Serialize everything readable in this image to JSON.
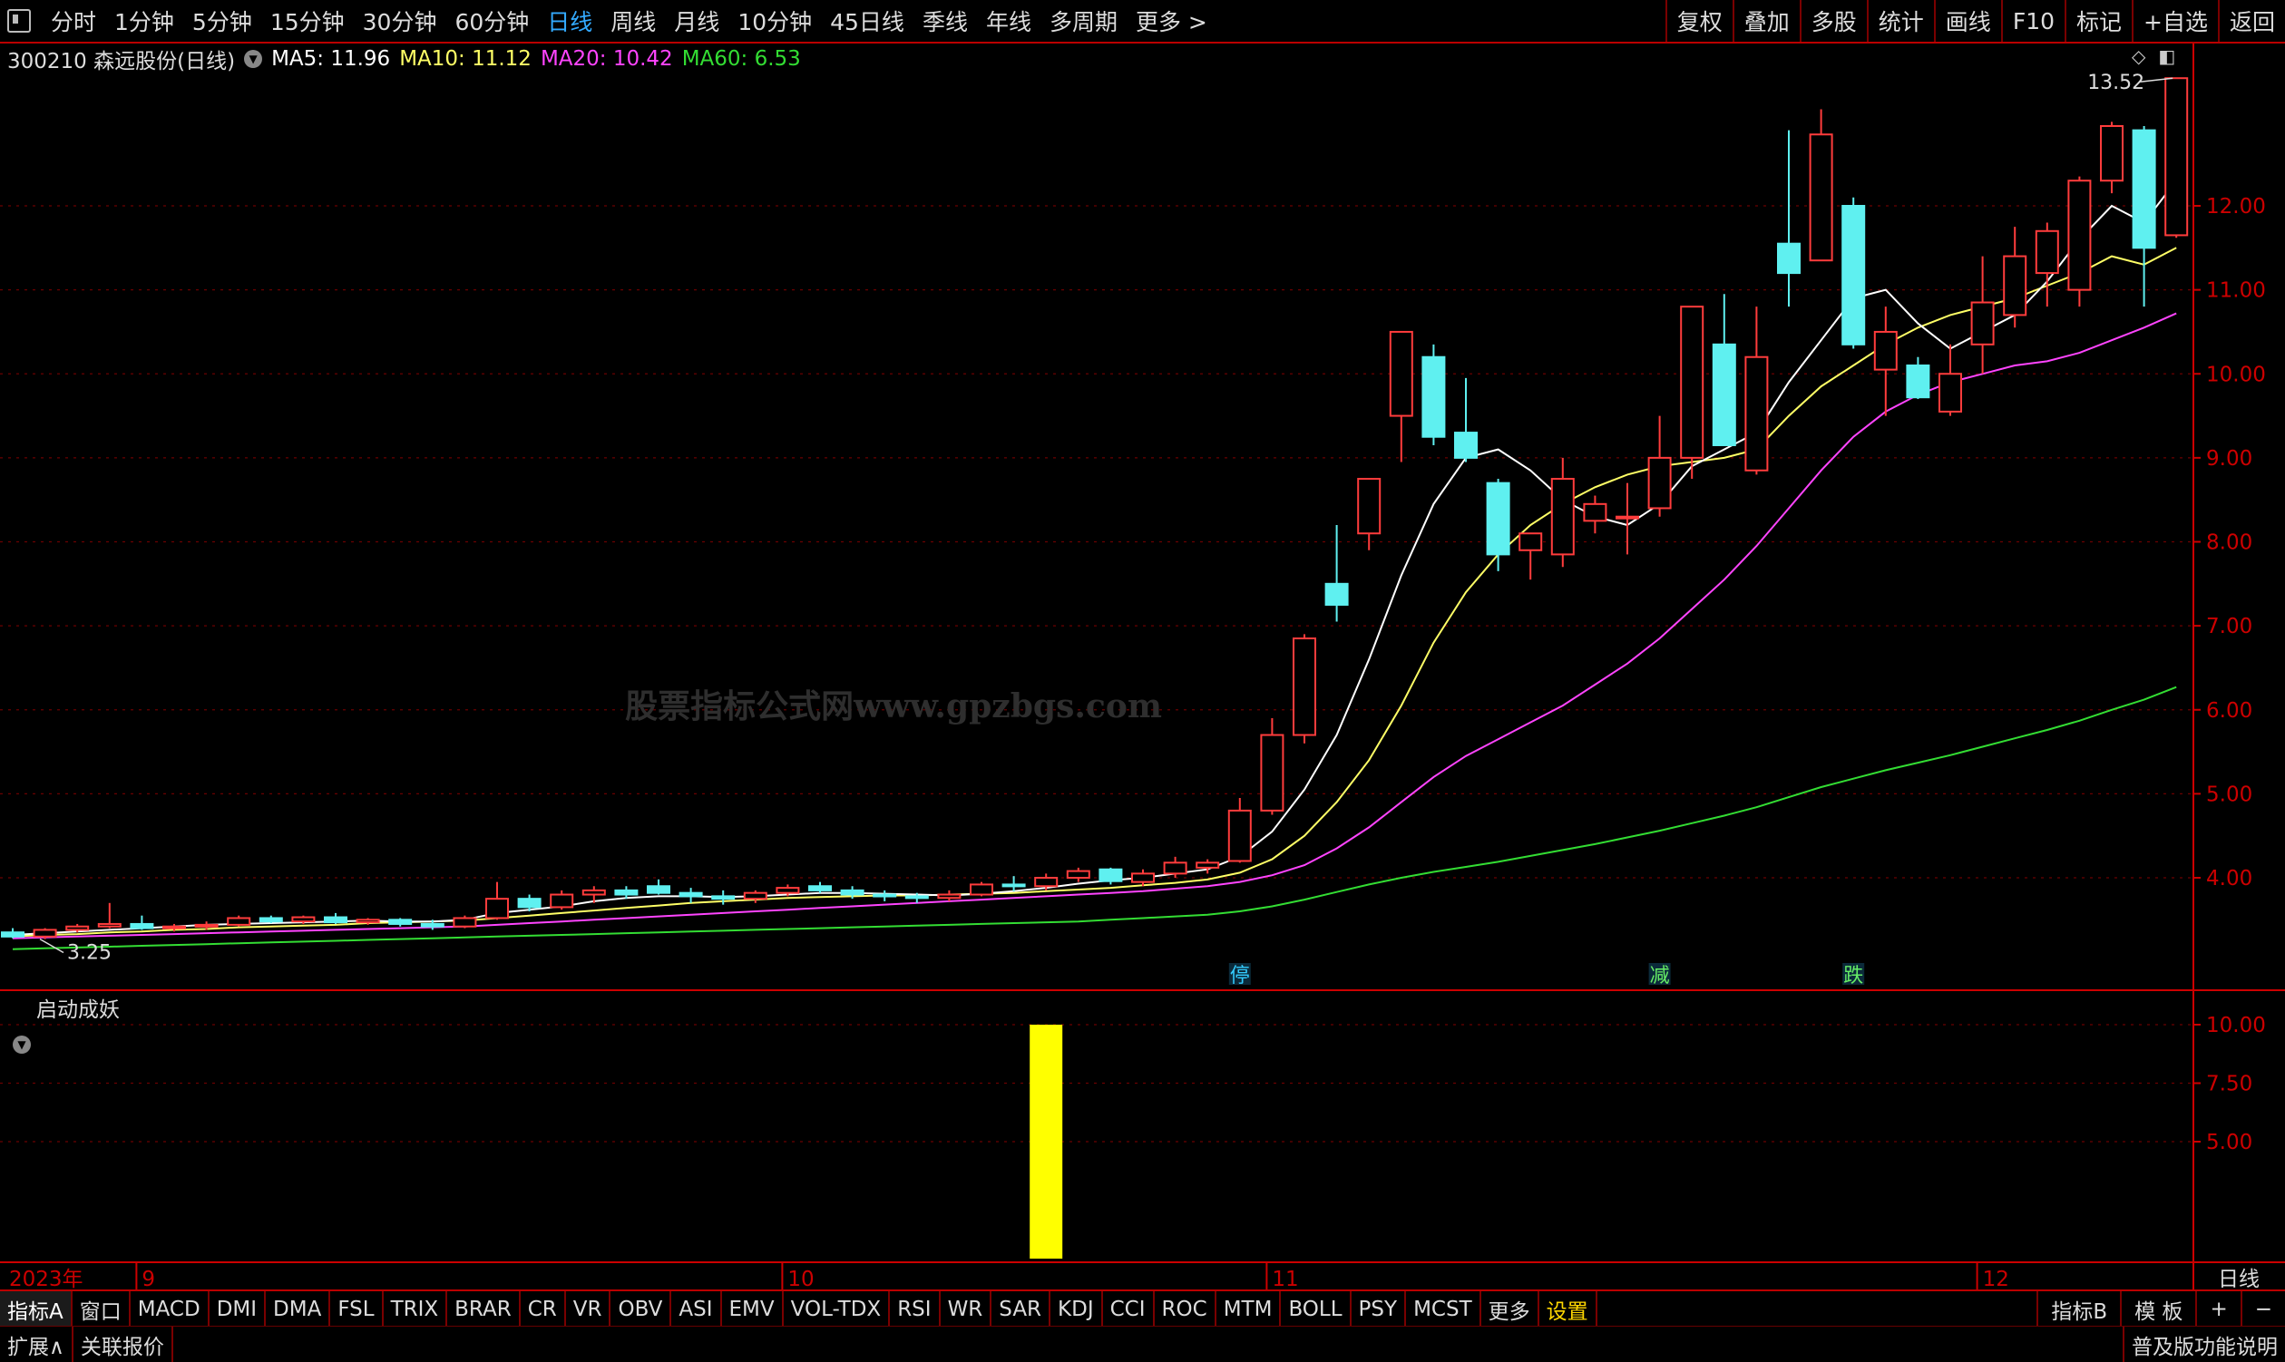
{
  "top_tabs": [
    "分时",
    "1分钟",
    "5分钟",
    "15分钟",
    "30分钟",
    "60分钟",
    "日线",
    "周线",
    "月线",
    "10分钟",
    "45日线",
    "季线",
    "年线",
    "多周期",
    "更多 >"
  ],
  "top_active": "日线",
  "right_tabs": [
    "复权",
    "叠加",
    "多股",
    "统计",
    "画线",
    "F10",
    "标记",
    "+自选",
    "返回"
  ],
  "stock": {
    "title": "300210 森远股份(日线)",
    "ma5": "MA5: 11.96",
    "ma10": "MA10: 11.12",
    "ma20": "MA20: 10.42",
    "ma60": "MA60: 6.53"
  },
  "colors": {
    "up": "#ff3c3c",
    "down": "#5ff0f0",
    "ma5": "#ffffff",
    "ma10": "#ffff66",
    "ma20": "#ff44ff",
    "ma60": "#33dd33",
    "axis": "#cc0000",
    "signal": "#ffff00"
  },
  "watermark": "股票指标公式网www.gpzbgs.com",
  "high_label": "13.52",
  "low_label": "3.25",
  "markers": [
    {
      "text": "停",
      "index": 38
    },
    {
      "text": "减",
      "index": 51
    },
    {
      "text": "跌",
      "index": 57
    }
  ],
  "price_axis": [
    "12.00",
    "11.00",
    "10.00",
    "9.00",
    "8.00",
    "7.00",
    "6.00",
    "5.00",
    "4.00"
  ],
  "sub_indicator": {
    "name": "启动成妖",
    "axis": [
      "10.00",
      "7.50",
      "5.00"
    ],
    "signal_index": 32,
    "signal_value": 10
  },
  "time_axis": {
    "year": "2023年",
    "months": [
      {
        "label": "9",
        "index": 4
      },
      {
        "label": "10",
        "index": 24
      },
      {
        "label": "11",
        "index": 39
      },
      {
        "label": "12",
        "index": 61
      }
    ],
    "period": "日线"
  },
  "bottom_tabs": [
    "指标A",
    "窗口",
    "MACD",
    "DMI",
    "DMA",
    "FSL",
    "TRIX",
    "BRAR",
    "CR",
    "VR",
    "OBV",
    "ASI",
    "EMV",
    "VOL-TDX",
    "RSI",
    "WR",
    "SAR",
    "KDJ",
    "CCI",
    "ROC",
    "MTM",
    "BOLL",
    "PSY",
    "MCST",
    "更多",
    "设置"
  ],
  "bottom_right": [
    "指标B",
    "模 板",
    "+",
    "−"
  ],
  "bottom_row2": [
    "扩展∧",
    "关联报价"
  ],
  "bottom_row2_right": "普及版功能说明",
  "chart_data": {
    "type": "candlestick",
    "title": "300210 森远股份(日线)",
    "ylim": [
      3.0,
      14.0
    ],
    "candles": [
      [
        3.35,
        3.4,
        3.28,
        3.3
      ],
      [
        3.3,
        3.4,
        3.27,
        3.38
      ],
      [
        3.38,
        3.45,
        3.35,
        3.42
      ],
      [
        3.42,
        3.7,
        3.4,
        3.45
      ],
      [
        3.45,
        3.55,
        3.38,
        3.4
      ],
      [
        3.4,
        3.45,
        3.36,
        3.42
      ],
      [
        3.42,
        3.48,
        3.38,
        3.44
      ],
      [
        3.44,
        3.55,
        3.42,
        3.52
      ],
      [
        3.52,
        3.55,
        3.46,
        3.48
      ],
      [
        3.48,
        3.55,
        3.45,
        3.53
      ],
      [
        3.53,
        3.58,
        3.45,
        3.47
      ],
      [
        3.47,
        3.52,
        3.44,
        3.5
      ],
      [
        3.5,
        3.52,
        3.42,
        3.45
      ],
      [
        3.45,
        3.5,
        3.38,
        3.42
      ],
      [
        3.42,
        3.55,
        3.4,
        3.52
      ],
      [
        3.52,
        3.95,
        3.5,
        3.75
      ],
      [
        3.75,
        3.8,
        3.6,
        3.65
      ],
      [
        3.65,
        3.85,
        3.62,
        3.8
      ],
      [
        3.8,
        3.9,
        3.7,
        3.85
      ],
      [
        3.85,
        3.9,
        3.75,
        3.8
      ],
      [
        3.9,
        3.98,
        3.8,
        3.82
      ],
      [
        3.82,
        3.88,
        3.7,
        3.78
      ],
      [
        3.78,
        3.85,
        3.68,
        3.75
      ],
      [
        3.75,
        3.85,
        3.7,
        3.82
      ],
      [
        3.82,
        3.92,
        3.78,
        3.88
      ],
      [
        3.9,
        3.95,
        3.82,
        3.85
      ],
      [
        3.85,
        3.9,
        3.75,
        3.8
      ],
      [
        3.8,
        3.85,
        3.72,
        3.78
      ],
      [
        3.78,
        3.82,
        3.7,
        3.76
      ],
      [
        3.76,
        3.85,
        3.72,
        3.8
      ],
      [
        3.8,
        3.95,
        3.78,
        3.92
      ],
      [
        3.92,
        4.02,
        3.84,
        3.9
      ],
      [
        3.9,
        4.05,
        3.85,
        4.0
      ],
      [
        4.0,
        4.12,
        3.95,
        4.08
      ],
      [
        4.1,
        4.12,
        3.92,
        3.96
      ],
      [
        3.95,
        4.1,
        3.9,
        4.05
      ],
      [
        4.05,
        4.25,
        4.0,
        4.18
      ],
      [
        4.12,
        4.22,
        4.05,
        4.18
      ],
      [
        4.2,
        4.95,
        4.18,
        4.8
      ],
      [
        4.8,
        5.9,
        4.75,
        5.7
      ],
      [
        5.7,
        6.9,
        5.6,
        6.85
      ],
      [
        7.5,
        8.2,
        7.05,
        7.25
      ],
      [
        8.1,
        8.75,
        7.9,
        8.75
      ],
      [
        9.5,
        10.5,
        8.95,
        10.5
      ],
      [
        10.2,
        10.35,
        9.15,
        9.25
      ],
      [
        9.3,
        9.95,
        8.95,
        9.0
      ],
      [
        8.7,
        8.75,
        7.65,
        7.85
      ],
      [
        7.9,
        8.1,
        7.55,
        8.1
      ],
      [
        7.85,
        9.0,
        7.7,
        8.75
      ],
      [
        8.25,
        8.55,
        8.1,
        8.45
      ],
      [
        8.3,
        8.7,
        7.85,
        8.3
      ],
      [
        8.4,
        9.5,
        8.3,
        9.0
      ],
      [
        9.0,
        10.8,
        8.75,
        10.8
      ],
      [
        10.35,
        10.95,
        9.15,
        9.15
      ],
      [
        8.85,
        10.8,
        8.8,
        10.2
      ],
      [
        11.55,
        12.9,
        10.8,
        11.2
      ],
      [
        11.35,
        13.15,
        11.35,
        12.85
      ],
      [
        12.0,
        12.1,
        10.3,
        10.35
      ],
      [
        10.05,
        10.8,
        9.5,
        10.5
      ],
      [
        10.1,
        10.2,
        9.7,
        9.72
      ],
      [
        9.55,
        10.35,
        9.5,
        10.0
      ],
      [
        10.35,
        11.4,
        10.0,
        10.85
      ],
      [
        10.7,
        11.75,
        10.55,
        11.4
      ],
      [
        11.2,
        11.8,
        10.8,
        11.7
      ],
      [
        11.0,
        12.35,
        10.8,
        12.3
      ],
      [
        12.3,
        13.0,
        12.15,
        12.95
      ],
      [
        12.9,
        12.95,
        10.8,
        11.5
      ],
      [
        11.65,
        13.52,
        11.62,
        13.52
      ]
    ],
    "ma5": [
      3.32,
      3.34,
      3.36,
      3.38,
      3.4,
      3.42,
      3.44,
      3.45,
      3.46,
      3.47,
      3.48,
      3.49,
      3.48,
      3.48,
      3.5,
      3.58,
      3.62,
      3.66,
      3.72,
      3.76,
      3.78,
      3.78,
      3.77,
      3.78,
      3.8,
      3.82,
      3.82,
      3.81,
      3.8,
      3.79,
      3.81,
      3.84,
      3.88,
      3.93,
      3.97,
      4.0,
      4.05,
      4.1,
      4.25,
      4.55,
      5.05,
      5.7,
      6.6,
      7.6,
      8.45,
      9.0,
      9.1,
      8.85,
      8.5,
      8.3,
      8.2,
      8.45,
      8.9,
      9.1,
      9.3,
      9.9,
      10.4,
      10.9,
      11.0,
      10.6,
      10.3,
      10.5,
      10.7,
      11.1,
      11.6,
      12.0,
      11.8,
      12.3
    ],
    "ma10": [
      3.3,
      3.32,
      3.33,
      3.35,
      3.36,
      3.38,
      3.39,
      3.41,
      3.42,
      3.43,
      3.44,
      3.46,
      3.47,
      3.48,
      3.49,
      3.52,
      3.55,
      3.58,
      3.61,
      3.64,
      3.67,
      3.7,
      3.72,
      3.74,
      3.76,
      3.77,
      3.78,
      3.79,
      3.79,
      3.8,
      3.81,
      3.82,
      3.84,
      3.86,
      3.88,
      3.91,
      3.94,
      3.98,
      4.06,
      4.22,
      4.5,
      4.9,
      5.4,
      6.05,
      6.8,
      7.4,
      7.85,
      8.2,
      8.45,
      8.65,
      8.8,
      8.9,
      8.95,
      9.0,
      9.1,
      9.5,
      9.85,
      10.1,
      10.35,
      10.55,
      10.7,
      10.8,
      10.9,
      11.05,
      11.2,
      11.4,
      11.3,
      11.5
    ],
    "ma20": [
      3.28,
      3.29,
      3.3,
      3.31,
      3.32,
      3.33,
      3.34,
      3.35,
      3.36,
      3.37,
      3.38,
      3.39,
      3.4,
      3.41,
      3.42,
      3.44,
      3.46,
      3.48,
      3.5,
      3.52,
      3.54,
      3.56,
      3.58,
      3.6,
      3.62,
      3.64,
      3.66,
      3.68,
      3.7,
      3.72,
      3.74,
      3.76,
      3.78,
      3.8,
      3.82,
      3.84,
      3.87,
      3.9,
      3.95,
      4.03,
      4.15,
      4.35,
      4.6,
      4.9,
      5.2,
      5.45,
      5.65,
      5.85,
      6.05,
      6.3,
      6.55,
      6.85,
      7.2,
      7.55,
      7.95,
      8.4,
      8.85,
      9.25,
      9.55,
      9.75,
      9.9,
      10.0,
      10.1,
      10.15,
      10.25,
      10.4,
      10.55,
      10.72
    ],
    "ma60": [
      3.15,
      3.16,
      3.17,
      3.18,
      3.19,
      3.2,
      3.21,
      3.22,
      3.23,
      3.24,
      3.25,
      3.26,
      3.27,
      3.28,
      3.29,
      3.3,
      3.31,
      3.32,
      3.33,
      3.34,
      3.35,
      3.36,
      3.37,
      3.38,
      3.39,
      3.4,
      3.41,
      3.42,
      3.43,
      3.44,
      3.45,
      3.46,
      3.47,
      3.48,
      3.5,
      3.52,
      3.54,
      3.56,
      3.6,
      3.66,
      3.74,
      3.83,
      3.92,
      4.0,
      4.07,
      4.13,
      4.19,
      4.26,
      4.33,
      4.4,
      4.48,
      4.56,
      4.65,
      4.74,
      4.84,
      4.96,
      5.08,
      5.18,
      5.28,
      5.37,
      5.46,
      5.56,
      5.66,
      5.76,
      5.87,
      6.0,
      6.12,
      6.27
    ]
  }
}
